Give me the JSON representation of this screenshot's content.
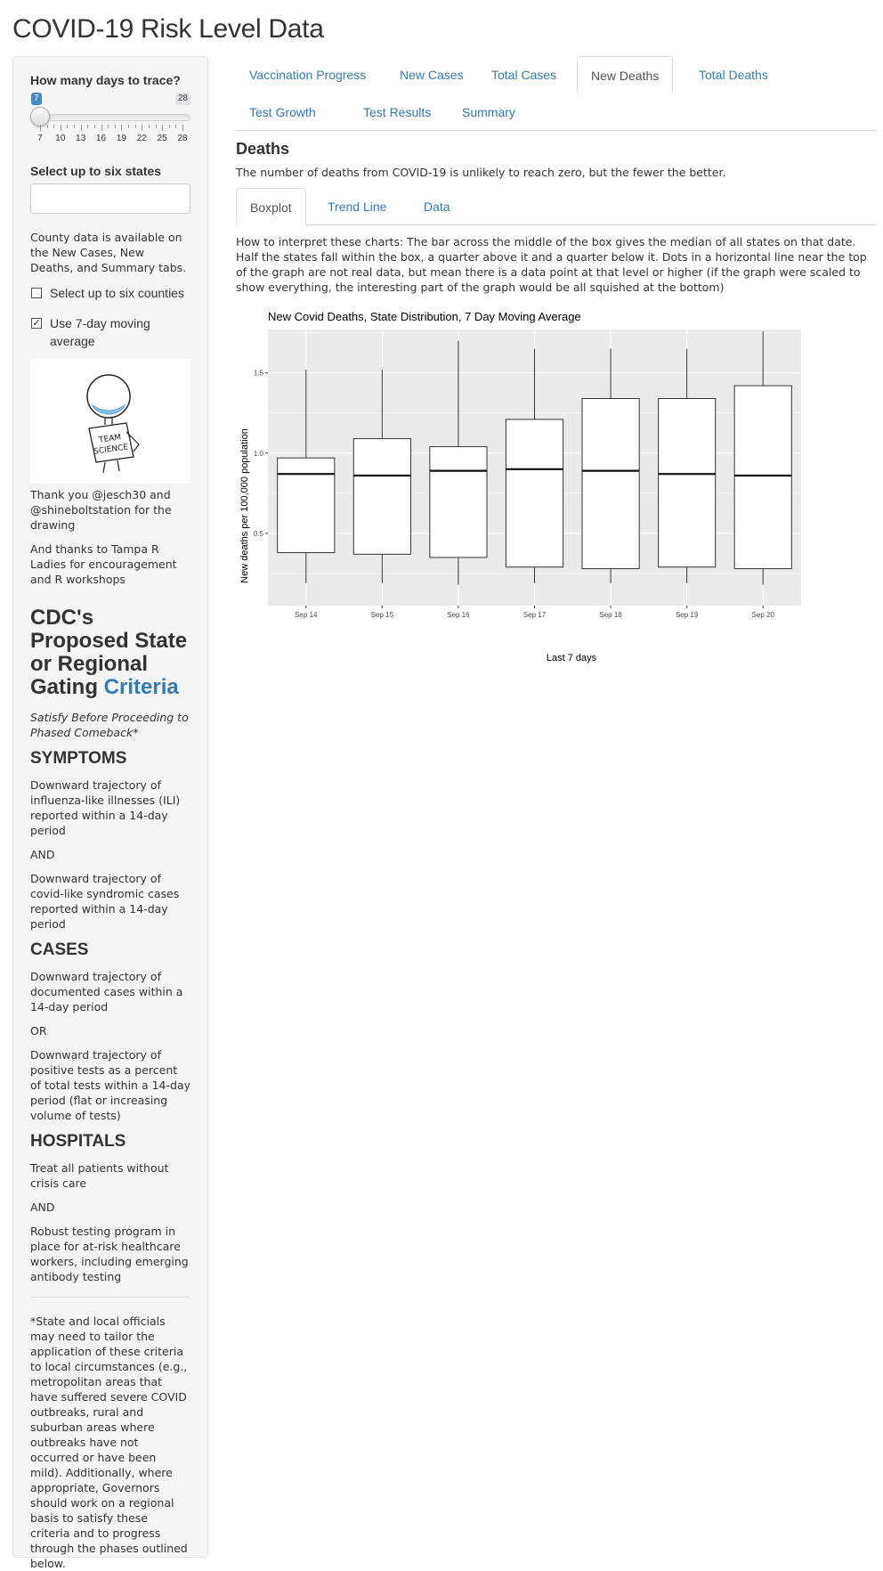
{
  "app": {
    "title": "COVID-19 Risk Level Data"
  },
  "sidebar": {
    "days_label": "How many days to trace?",
    "slider": {
      "min": 7,
      "max": 28,
      "value": 7,
      "tick_labels": [
        "7",
        "10",
        "13",
        "16",
        "19",
        "22",
        "25",
        "28"
      ]
    },
    "states_label": "Select up to six states",
    "county_note": "County data is available on the New Cases, New Deaths, and Summary tabs.",
    "counties_checkbox": {
      "label": "Select up to six counties",
      "checked": false
    },
    "moving_avg_checkbox": {
      "label": "Use 7-day moving average",
      "checked": true
    },
    "drawing": {
      "sign_line1": "TEAM",
      "sign_line2": "SCIENCE"
    },
    "thanks1": "Thank you @jesch30 and @shineboltstation for the drawing",
    "thanks2": "And thanks to Tampa R Ladies for encouragement and R workshops",
    "cdc_title_prefix": "CDC's Proposed State or Regional Gating ",
    "cdc_title_link": "Criteria",
    "cdc_subtitle": "Satisfy Before Proceeding to Phased Comeback*",
    "symptoms": {
      "heading": "SYMPTOMS",
      "p1": "Downward trajectory of influenza-like illnesses (ILI) reported within a 14-day period",
      "join": "AND",
      "p2": "Downward trajectory of covid-like syndromic cases reported within a 14-day period"
    },
    "cases": {
      "heading": "CASES",
      "p1": "Downward trajectory of documented cases within a 14-day period",
      "join": "OR",
      "p2": "Downward trajectory of positive tests as a percent of total tests within a 14-day period (flat or increasing volume of tests)"
    },
    "hospitals": {
      "heading": "HOSPITALS",
      "p1": "Treat all patients without crisis care",
      "join": "AND",
      "p2": "Robust testing program in place for at-risk healthcare workers, including emerging antibody testing"
    },
    "footnote": "*State and local officials may need to tailor the application of these criteria to local circumstances (e.g., metropolitan areas that have suffered severe COVID outbreaks, rural and suburban areas where outbreaks have not occurred or have been mild). Additionally, where appropriate, Governors should work on a regional basis to satisfy these criteria and to progress through the phases outlined below."
  },
  "tabs": [
    {
      "label": "Vaccination Progress",
      "active": false
    },
    {
      "label": "New Cases",
      "active": false
    },
    {
      "label": "Total Cases",
      "active": false
    },
    {
      "label": "New Deaths",
      "active": true
    },
    {
      "label": "Total Deaths",
      "active": false
    },
    {
      "label": "Test Growth",
      "active": false
    },
    {
      "label": "Test Results",
      "active": false
    },
    {
      "label": "Summary",
      "active": false
    }
  ],
  "main": {
    "section_title": "Deaths",
    "description": "The number of deaths from COVID-19 is unlikely to reach zero, but the fewer the better.",
    "subtabs": [
      {
        "label": "Boxplot",
        "active": true
      },
      {
        "label": "Trend Line",
        "active": false
      },
      {
        "label": "Data",
        "active": false
      }
    ],
    "interpretation": "How to interpret these charts: The bar across the middle of the box gives the median of all states on that date. Half the states fall within the box, a quarter above it and a quarter below it. Dots in a horizontal line near the top of the graph are not real data, but mean there is a data point at that level or higher (if the graph were scaled to show everything, the interesting part of the graph would be all squished at the bottom)"
  },
  "colors": {
    "accent": "#337ab7",
    "slider_active": "#428bca",
    "panel_bg": "#ebebeb",
    "box_fill": "#ffffff"
  },
  "chart_data": {
    "type": "boxplot",
    "title": "New Covid Deaths, State Distribution, 7 Day Moving Average",
    "xlabel": "Last 7 days",
    "ylabel": "New deaths per 100,000 population",
    "categories": [
      "Sep 14",
      "Sep 15",
      "Sep 16",
      "Sep 17",
      "Sep 18",
      "Sep 19",
      "Sep 20"
    ],
    "ylim": [
      0.05,
      1.77
    ],
    "yticks": [
      0.5,
      1.0,
      1.5
    ],
    "ytick_labels": [
      "0.5",
      "1.0",
      "1.5"
    ],
    "grid": true,
    "boxes": [
      {
        "low": 0.19,
        "q1": 0.38,
        "median": 0.87,
        "q3": 0.97,
        "high": 1.52
      },
      {
        "low": 0.19,
        "q1": 0.37,
        "median": 0.86,
        "q3": 1.09,
        "high": 1.52
      },
      {
        "low": 0.18,
        "q1": 0.35,
        "median": 0.89,
        "q3": 1.04,
        "high": 1.7
      },
      {
        "low": 0.19,
        "q1": 0.29,
        "median": 0.9,
        "q3": 1.21,
        "high": 1.65
      },
      {
        "low": 0.19,
        "q1": 0.28,
        "median": 0.89,
        "q3": 1.34,
        "high": 1.65
      },
      {
        "low": 0.19,
        "q1": 0.29,
        "median": 0.87,
        "q3": 1.34,
        "high": 1.65
      },
      {
        "low": 0.18,
        "q1": 0.28,
        "median": 0.86,
        "q3": 1.42,
        "high": 1.76
      }
    ]
  }
}
